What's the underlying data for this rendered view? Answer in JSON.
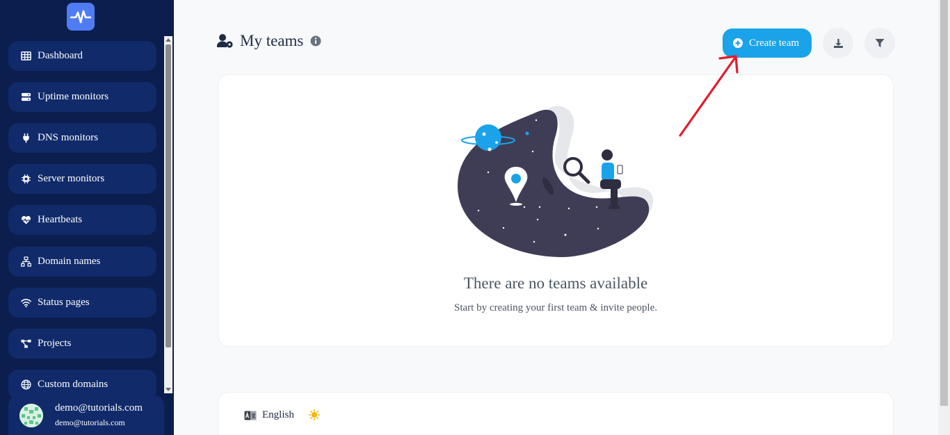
{
  "sidebar": {
    "items": [
      {
        "label": "Dashboard",
        "icon": "grid-icon"
      },
      {
        "label": "Uptime monitors",
        "icon": "server-icon"
      },
      {
        "label": "DNS monitors",
        "icon": "plug-icon"
      },
      {
        "label": "Server monitors",
        "icon": "chip-icon"
      },
      {
        "label": "Heartbeats",
        "icon": "heart-pulse-icon"
      },
      {
        "label": "Domain names",
        "icon": "sitemap-icon"
      },
      {
        "label": "Status pages",
        "icon": "wifi-icon"
      },
      {
        "label": "Projects",
        "icon": "project-diagram-icon"
      },
      {
        "label": "Custom domains",
        "icon": "globe-icon"
      }
    ],
    "user": {
      "name": "demo@tutorials.com",
      "email": "demo@tutorials.com"
    }
  },
  "header": {
    "title": "My teams",
    "create_label": "Create team"
  },
  "empty_state": {
    "title": "There are no teams available",
    "subtitle": "Start by creating your first team & invite people."
  },
  "footer": {
    "language": "English"
  },
  "colors": {
    "sidebar_bg": "#0b1e4d",
    "nav_item_bg": "#102a6a",
    "accent": "#1aa3e8",
    "annotation_arrow": "#e31b2d"
  }
}
